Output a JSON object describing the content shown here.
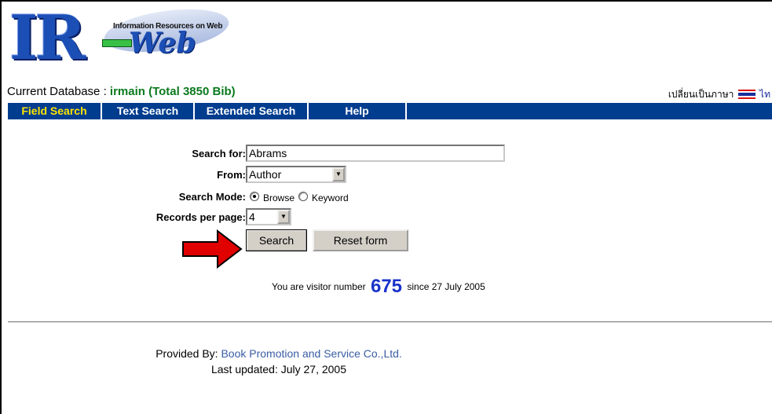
{
  "logo": {
    "letters": "IR",
    "dash": "-",
    "web": "Web",
    "tagline": "Information Resources on Web"
  },
  "database": {
    "label": "Current Database : ",
    "value": "irmain (Total 3850 Bib)"
  },
  "language": {
    "label": "เปลี่ยนเป็นภาษา",
    "target": "ไท"
  },
  "nav": {
    "items": [
      {
        "label": "Field Search",
        "active": true
      },
      {
        "label": "Text Search",
        "active": false
      },
      {
        "label": "Extended Search",
        "active": false
      },
      {
        "label": "Help",
        "active": false
      }
    ]
  },
  "form": {
    "search_for_label": "Search for:",
    "search_for_value": "Abrams",
    "from_label": "From:",
    "from_value": "Author",
    "mode_label": "Search Mode:",
    "mode_options": [
      {
        "label": "Browse",
        "selected": true
      },
      {
        "label": "Keyword",
        "selected": false
      }
    ],
    "records_label": "Records per page:",
    "records_value": "4",
    "search_button": "Search",
    "reset_button": "Reset form"
  },
  "visitor": {
    "prefix": "You are visitor number",
    "count": "675",
    "suffix": "since 27 July 2005"
  },
  "footer": {
    "provided_label": "Provided By: ",
    "company": "Book Promotion and Service Co.,Ltd.",
    "updated": "Last updated: July 27, 2005"
  },
  "colors": {
    "nav_bg": "#003d8f",
    "nav_active": "#ffe400",
    "db_value": "#0b7a1e",
    "visitor_count": "#1a33c9",
    "arrow": "#e00000"
  }
}
